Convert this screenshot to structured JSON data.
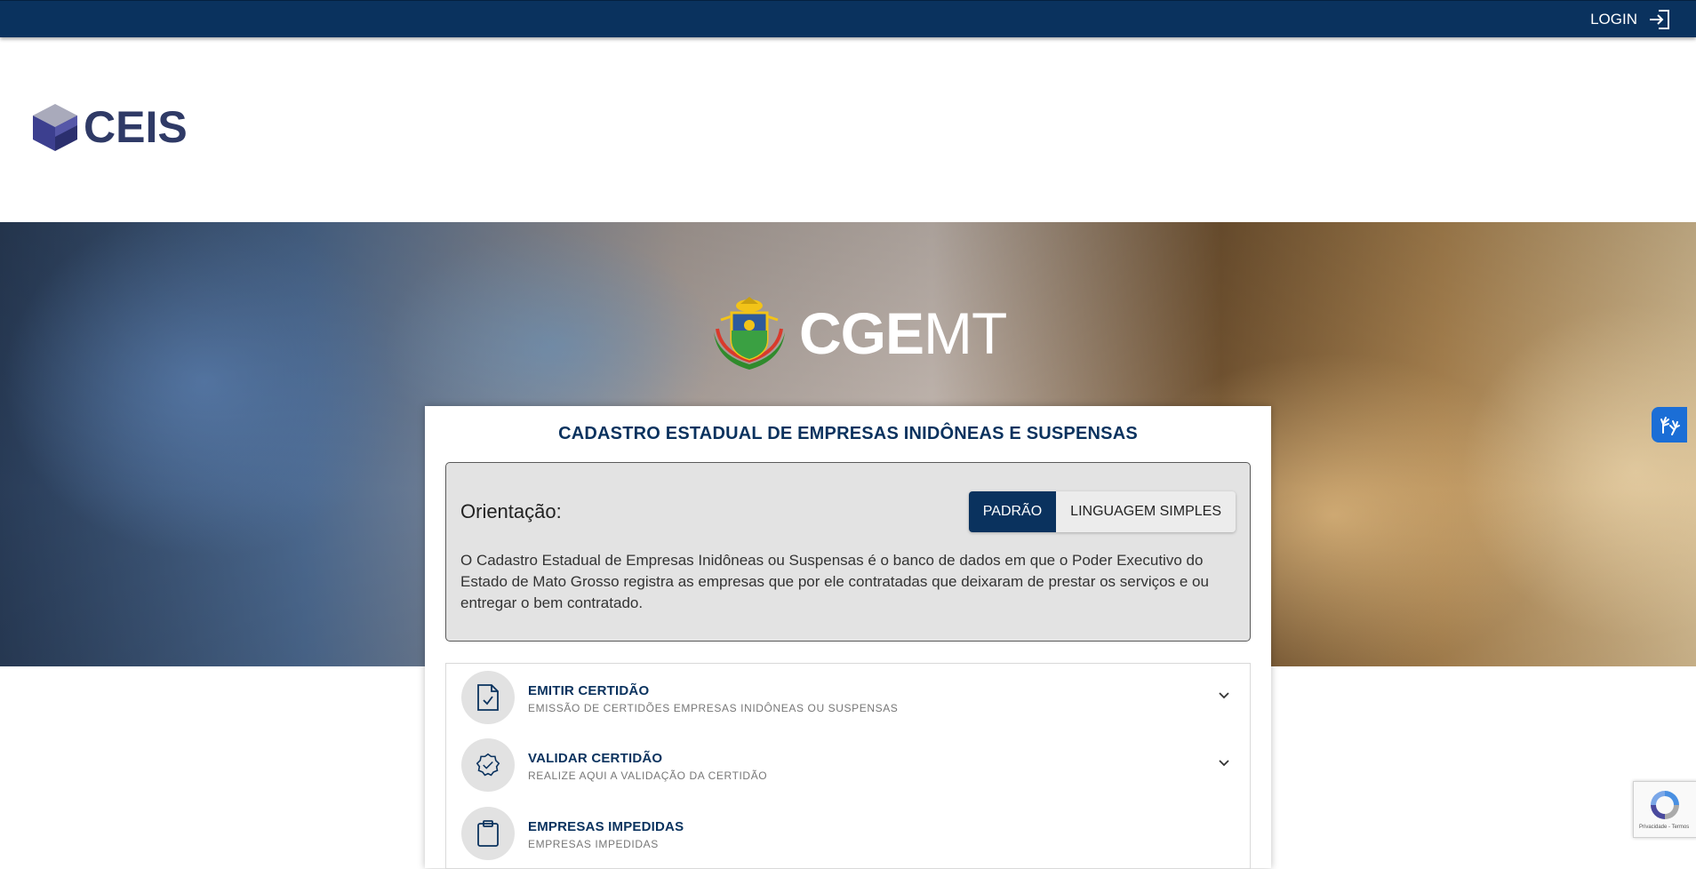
{
  "header": {
    "login_label": "LOGIN",
    "login_icon": "sign-in-icon"
  },
  "logo": {
    "text": "CEIS"
  },
  "hero": {
    "brand_bold": "CGE",
    "brand_light": "MT"
  },
  "panel": {
    "title": "CADASTRO ESTADUAL DE EMPRESAS INIDÔNEAS E SUSPENSAS",
    "orientation": {
      "label": "Orientação:",
      "toggle_options": [
        "PADRÃO",
        "LINGUAGEM SIMPLES"
      ],
      "selected": "PADRÃO",
      "text": "O Cadastro Estadual de Empresas Inidôneas ou Suspensas é o banco de dados em que o Poder Executivo do Estado de Mato Grosso registra as empresas que por ele contratadas que deixaram de prestar os serviços e ou entregar o bem contratado."
    },
    "accordion": [
      {
        "title": "EMITIR CERTIDÃO",
        "subtitle": "EMISSÃO DE CERTIDÕES EMPRESAS INIDÔNEAS OU SUSPENSAS",
        "icon": "document-check-icon"
      },
      {
        "title": "VALIDAR CERTIDÃO",
        "subtitle": "REALIZE AQUI A VALIDAÇÃO DA CERTIDÃO",
        "icon": "badge-check-icon"
      },
      {
        "title": "EMPRESAS IMPEDIDAS",
        "subtitle": "EMPRESAS IMPEDIDAS",
        "icon": "clipboard-icon"
      }
    ]
  },
  "widgets": {
    "recaptcha_text": "Privacidade - Termos",
    "accessibility_icon": "sign-language-hands-icon"
  },
  "colors": {
    "primary": "#0a325e",
    "logo": "#2f3a66",
    "accessibility": "#1b6ed6"
  }
}
